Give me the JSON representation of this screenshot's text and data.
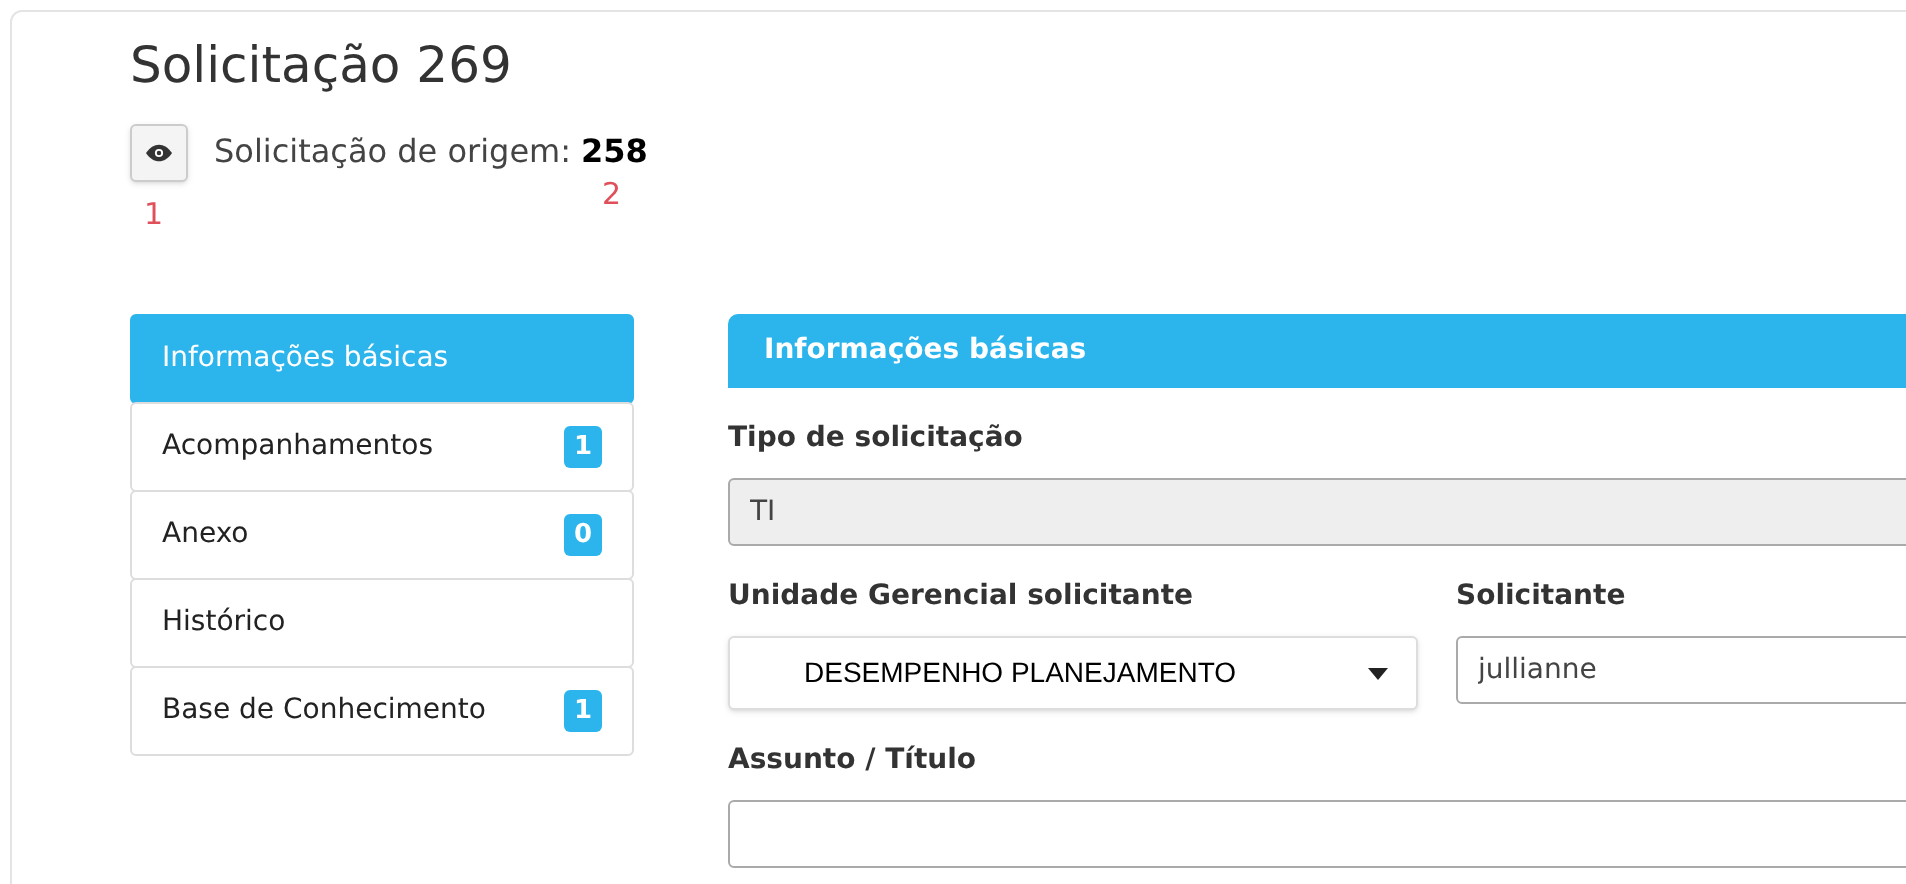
{
  "title": "Solicitação 269",
  "origin": {
    "label": "Solicitação de origem:",
    "number": "258"
  },
  "annotations": [
    {
      "text": "1",
      "color": "#e0505a"
    },
    {
      "text": "2",
      "color": "#e0505a"
    }
  ],
  "sidebar": {
    "items": [
      {
        "label": "Informações básicas",
        "selected": true
      },
      {
        "label": "Acompanhamentos",
        "selected": false,
        "badge": "1"
      },
      {
        "label": "Anexo",
        "selected": false,
        "badge": "0"
      },
      {
        "label": "Histórico",
        "selected": false
      },
      {
        "label": "Base de Conhecimento",
        "selected": false,
        "badge": "1"
      }
    ]
  },
  "panel": {
    "title": "Informações básicas",
    "fields": [
      {
        "kind": "text",
        "label": "Tipo de solicitação",
        "value": "TI",
        "disabled": true
      },
      {
        "kind": "select",
        "label": "Unidade Gerencial solicitante",
        "value": "DESEMPENHO PLANEJAMENTO"
      },
      {
        "kind": "text",
        "label": "Solicitante",
        "value": "jullianne",
        "disabled": false
      },
      {
        "kind": "text",
        "label": "Assunto / Título",
        "disabled": false
      }
    ]
  }
}
